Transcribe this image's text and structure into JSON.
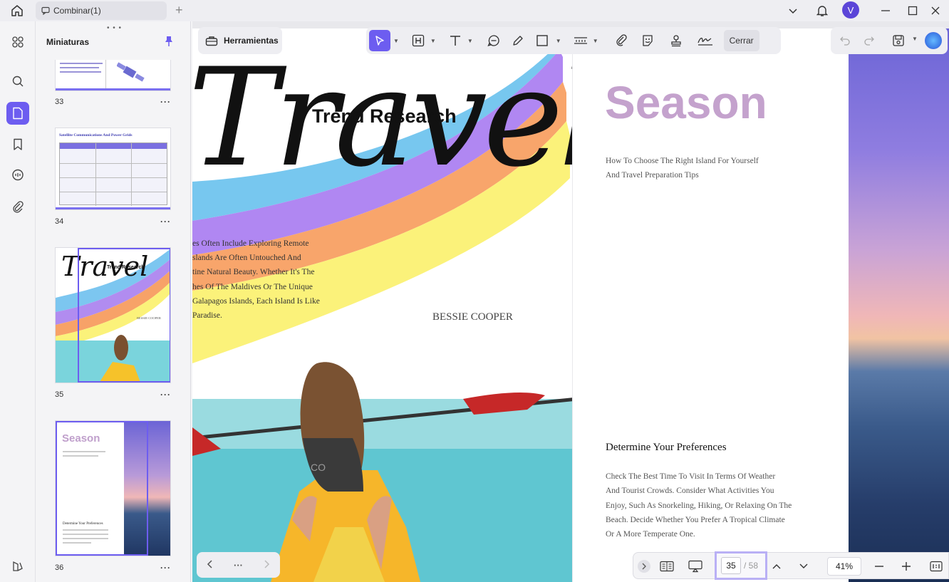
{
  "tab": {
    "label": "Combinar(1)"
  },
  "avatar": {
    "initial": "V"
  },
  "colors": {
    "accent": "#6d5df0"
  },
  "thumbnails": {
    "title": "Miniaturas",
    "items": [
      {
        "page": "33"
      },
      {
        "page": "34",
        "heading": "Satellite Communications And Power Grids"
      },
      {
        "page": "35",
        "title": "Travel",
        "subtitle": "Trend Research",
        "author": "BESSIE COOPER"
      },
      {
        "page": "36",
        "title": "Season",
        "heading": "Determine Your Preferences"
      }
    ]
  },
  "toolbar": {
    "herramientas": "Herramientas",
    "cerrar": "Cerrar"
  },
  "doc": {
    "left": {
      "script_title": "Travel",
      "subtitle": "Trend Research",
      "body_lines": [
        "es Often Include Exploring Remote",
        "slands Are Often Untouched And",
        "tine Natural Beauty. Whether It's The",
        "hes Of The Maldives Or The Unique",
        "Galapagos Islands, Each Island Is Like",
        "Paradise."
      ],
      "author": "BESSIE COOPER",
      "kayak_letters": "CO"
    },
    "right": {
      "title": "Season",
      "intro_lines": [
        "How To Choose The Right Island For Yourself",
        "And Travel Preparation Tips"
      ],
      "section_heading": "Determine Your Preferences",
      "section_lines": [
        "Check The Best Time To Visit In Terms Of Weather",
        "And Tourist Crowds. Consider What Activities You",
        "Enjoy, Such As Snorkeling, Hiking, Or Relaxing On The",
        "Beach. Decide Whether You Prefer A Tropical Climate",
        "Or A More Temperate One."
      ]
    }
  },
  "pager": {
    "current": "35",
    "total": "/ 58",
    "zoom": "41%",
    "more": "···"
  }
}
